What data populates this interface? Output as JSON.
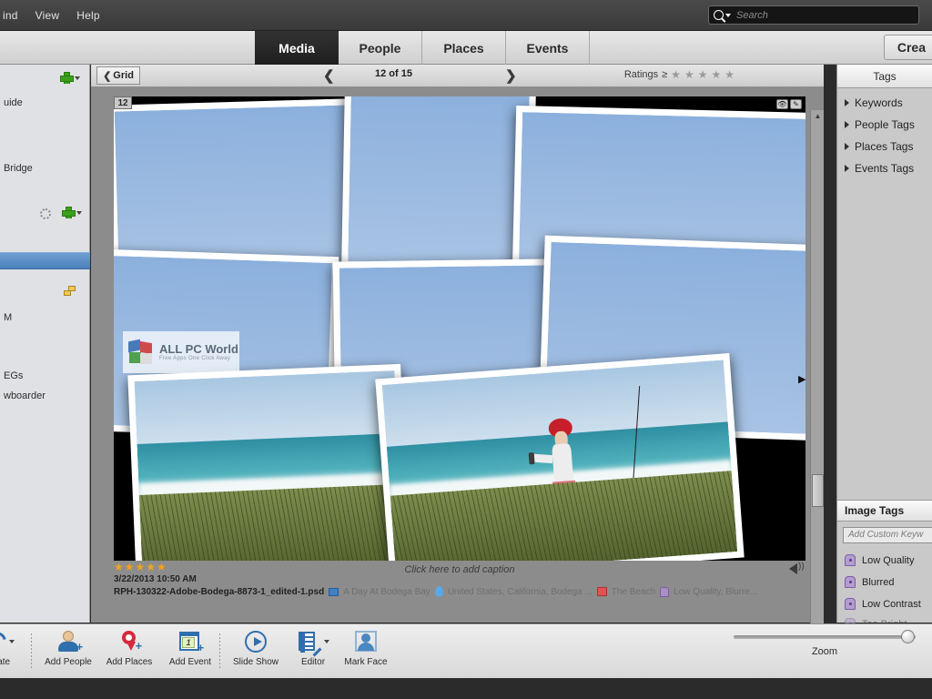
{
  "app": {
    "menu": [
      "ind",
      "View",
      "Help"
    ],
    "search": {
      "placeholder": "Search",
      "icon": "search-icon"
    }
  },
  "tabbar": {
    "tabs": [
      {
        "label": "Media",
        "active": true
      },
      {
        "label": "People",
        "active": false
      },
      {
        "label": "Places",
        "active": false
      },
      {
        "label": "Events",
        "active": false
      }
    ],
    "create_label": "Crea"
  },
  "sidebar": {
    "items": [
      {
        "label": "uide"
      },
      {
        "label": "Bridge"
      },
      {
        "label": "M"
      },
      {
        "label": "EGs"
      },
      {
        "label": "wboarder"
      }
    ],
    "icons": [
      "plus-icon",
      "plus-icon",
      "refresh-icon",
      "stack-icon"
    ]
  },
  "gridbar": {
    "grid_label": "Grid",
    "prev_icon": "chevron-left-icon",
    "next_icon": "chevron-right-icon",
    "counter": "12 of 15",
    "ratings_label": "Ratings",
    "ratings_operator": "≥",
    "ratings_star_count": 5,
    "ratings_filled": 0
  },
  "photo": {
    "number_badge": "12",
    "corner_icons": [
      "eye-icon",
      "edit-icon"
    ],
    "caption_placeholder": "Click here to add caption",
    "rating": 5,
    "rating_max": 5,
    "date": "3/22/2013 10:50 AM",
    "filename": "RPH-130322-Adobe-Bodega-8873-1_edited-1.psd",
    "album": "A Day At Bodega Bay",
    "place": "United States, California, Bodega ...",
    "event": "The Beach",
    "keywords": "Low Quality, Blurre...",
    "audio_icon": "speaker-icon",
    "watermark": {
      "title": "ALL PC World",
      "subtitle": "Free Apps One Click Away"
    }
  },
  "rightpanel": {
    "title": "Tags",
    "tags": [
      {
        "label": "Keywords"
      },
      {
        "label": "People Tags"
      },
      {
        "label": "Places Tags"
      },
      {
        "label": "Events Tags"
      }
    ],
    "image_tags_title": "Image Tags",
    "keyword_input_placeholder": "Add Custom Keyw",
    "image_tags": [
      {
        "label": "Low Quality"
      },
      {
        "label": "Blurred"
      },
      {
        "label": "Low Contrast"
      },
      {
        "label": "Too Bright"
      }
    ]
  },
  "bottom": {
    "tools": [
      {
        "label": "otate",
        "icon": "rotate-icon",
        "has_caret": true
      },
      {
        "label": "Add People",
        "icon": "add-person-icon",
        "has_caret": false
      },
      {
        "label": "Add Places",
        "icon": "map-pin-icon",
        "has_caret": false
      },
      {
        "label": "Add Event",
        "icon": "calendar-icon",
        "has_caret": false
      },
      {
        "label": "Slide Show",
        "icon": "play-icon",
        "has_caret": false
      },
      {
        "label": "Editor",
        "icon": "editor-icon",
        "has_caret": true
      },
      {
        "label": "Mark Face",
        "icon": "face-icon",
        "has_caret": false
      }
    ],
    "zoom_label": "Zoom",
    "zoom_value": 92
  },
  "colors": {
    "accent_blue": "#2f6fae",
    "selection_blue": "#4b7fba",
    "star_gold": "#f2a31b",
    "green_plus": "#3aa11a",
    "tag_purple": "#b49cd0"
  }
}
